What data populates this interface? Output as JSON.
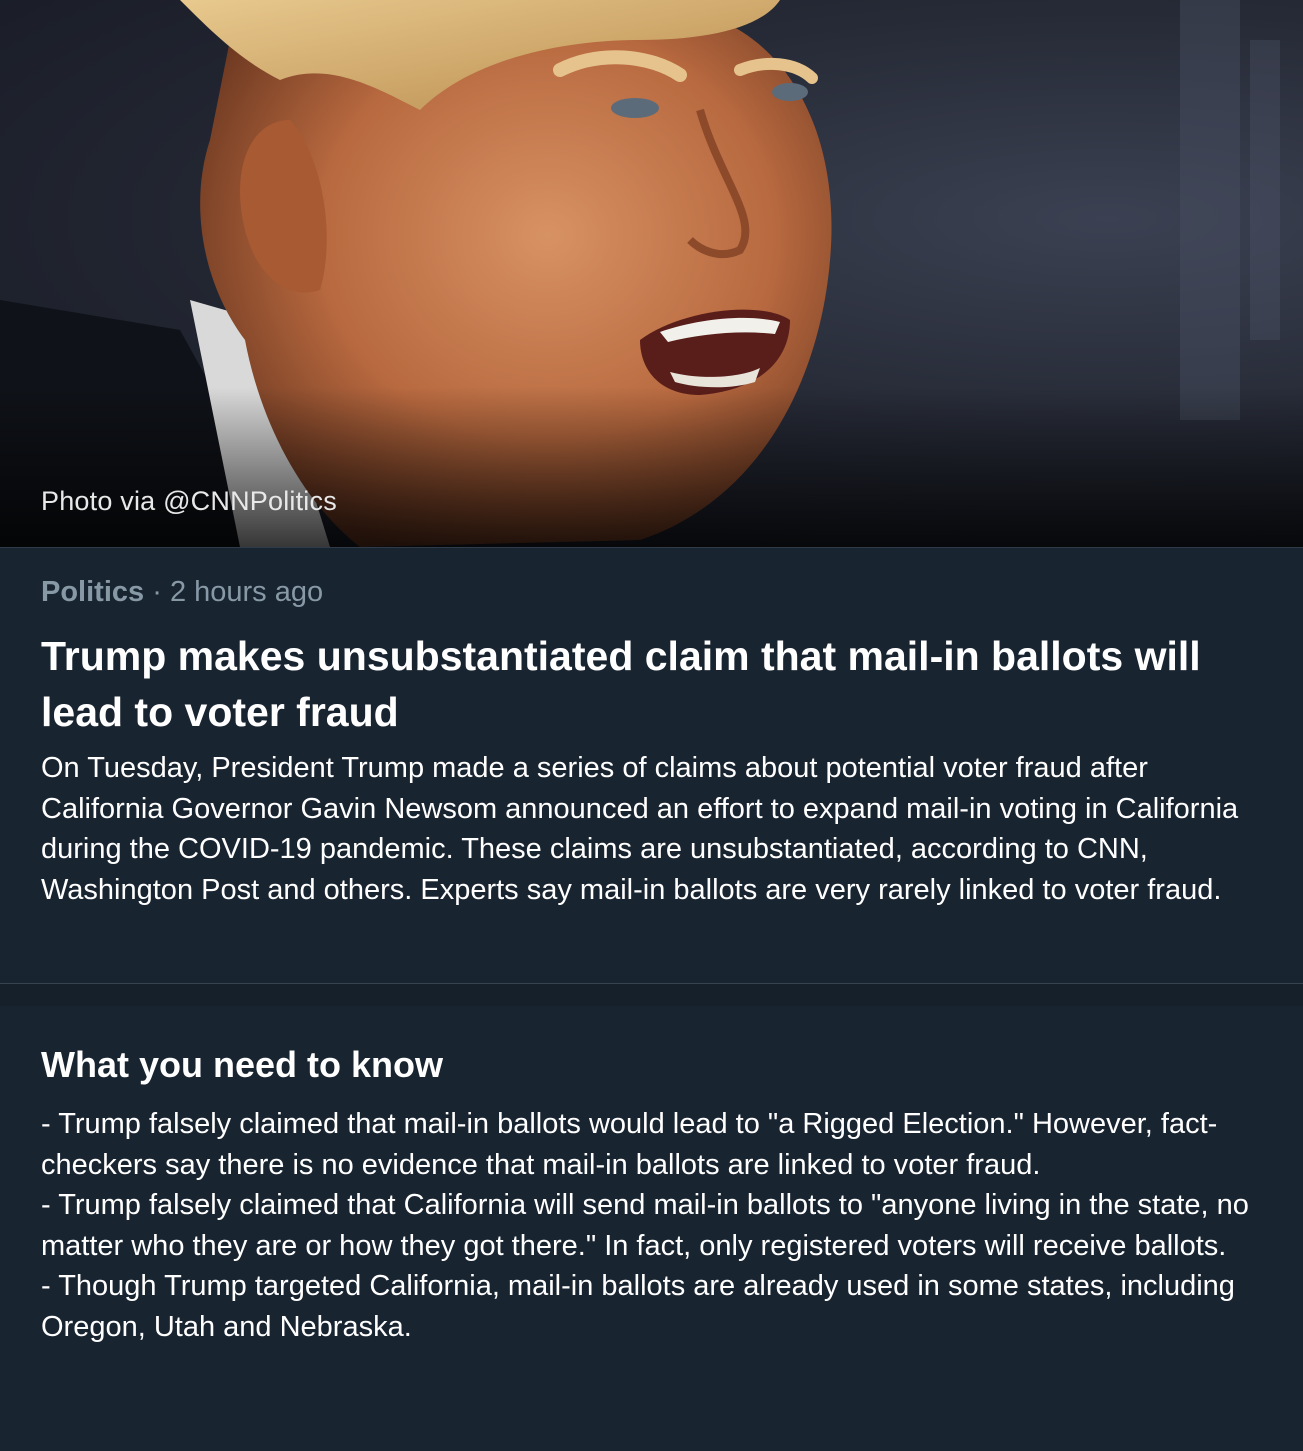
{
  "hero": {
    "image_description_icon": "news-photo",
    "photo_credit": "Photo via @CNNPolitics"
  },
  "article": {
    "category": "Politics",
    "separator": " · ",
    "time_ago": "2 hours ago",
    "headline": "Trump makes unsubstantiated claim that mail-in ballots will lead to voter fraud",
    "summary": "On Tuesday, President Trump made a series of claims about potential voter fraud after California Governor Gavin Newsom announced an effort to expand mail-in voting in California during the COVID-19 pandemic. These claims are unsubstantiated, according to CNN, Washington Post and others. Experts say mail-in ballots are very rarely linked to voter fraud."
  },
  "what_you_need_to_know": {
    "title": "What you need to know",
    "items": [
      "- Trump falsely claimed that mail-in ballots would lead to \"a Rigged Election.\" However, fact-checkers say there is no evidence that mail-in ballots are linked to voter fraud.",
      "- Trump falsely claimed that California will send mail-in ballots to \"anyone living in the state, no matter who they are or how they got there.\" In fact, only registered voters will receive ballots.",
      "- Though Trump targeted California, mail-in ballots are already used in some states, including Oregon, Utah and Nebraska."
    ]
  },
  "colors": {
    "background": "#15202b",
    "card": "#192431",
    "meta_text": "#8899a6",
    "divider": "#38444d"
  }
}
